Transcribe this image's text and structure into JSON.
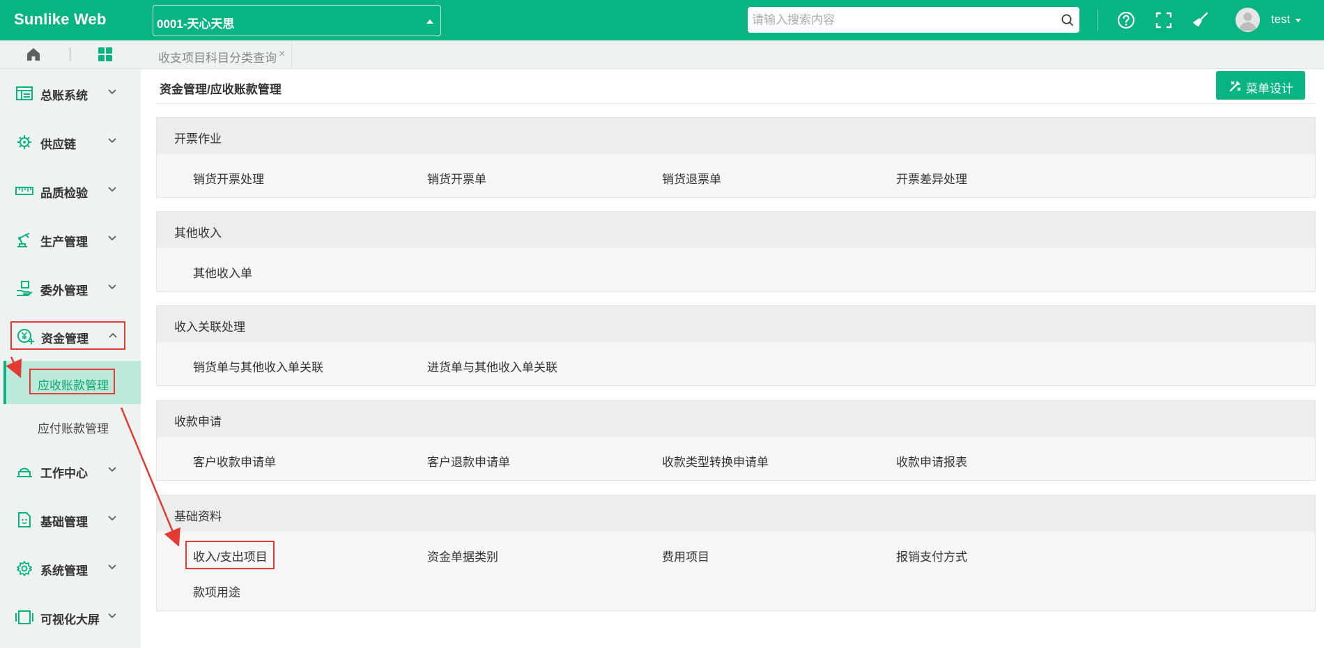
{
  "header": {
    "brand": "Sunlike Web",
    "org_value": "0001-天心天思",
    "search_placeholder": "请输入搜索内容",
    "user_name": "test"
  },
  "sidebar": {
    "items": [
      {
        "label": "总账系统",
        "icon": "ledger-icon"
      },
      {
        "label": "供应链",
        "icon": "supply-chain-icon"
      },
      {
        "label": "品质检验",
        "icon": "ruler-icon"
      },
      {
        "label": "生产管理",
        "icon": "robot-arm-icon"
      },
      {
        "label": "委外管理",
        "icon": "hand-box-icon"
      },
      {
        "label": "资金管理",
        "icon": "yuan-icon"
      },
      {
        "label": "工作中心",
        "icon": "workstation-icon"
      },
      {
        "label": "基础管理",
        "icon": "document-icon"
      },
      {
        "label": "系统管理",
        "icon": "gear-icon"
      },
      {
        "label": "可视化大屏",
        "icon": "screen-icon"
      }
    ],
    "sub_items": [
      {
        "label": "应收账款管理"
      },
      {
        "label": "应付账款管理"
      }
    ]
  },
  "tabs": [
    {
      "label": "收支项目科目分类查询",
      "close": "×"
    }
  ],
  "content": {
    "breadcrumb": "资金管理/应收账款管理",
    "menu_design_label": "菜单设计",
    "panels": [
      {
        "title": "开票作业",
        "links": [
          "销货开票处理",
          "销货开票单",
          "销货退票单",
          "开票差异处理"
        ]
      },
      {
        "title": "其他收入",
        "links": [
          "其他收入单"
        ]
      },
      {
        "title": "收入关联处理",
        "links": [
          "销货单与其他收入单关联",
          "进货单与其他收入单关联"
        ]
      },
      {
        "title": "收款申请",
        "links": [
          "客户收款申请单",
          "客户退款申请单",
          "收款类型转换申请单",
          "收款申请报表"
        ]
      },
      {
        "title": "基础资料",
        "links": [
          "收入/支出项目",
          "资金单据类别",
          "费用项目",
          "报销支付方式",
          "款项用途"
        ]
      }
    ]
  },
  "colors": {
    "accent": "#07b482",
    "highlight": "#e33b33",
    "sidebar_bg": "#eef2f1",
    "active_sub_bg": "#bde9da"
  }
}
